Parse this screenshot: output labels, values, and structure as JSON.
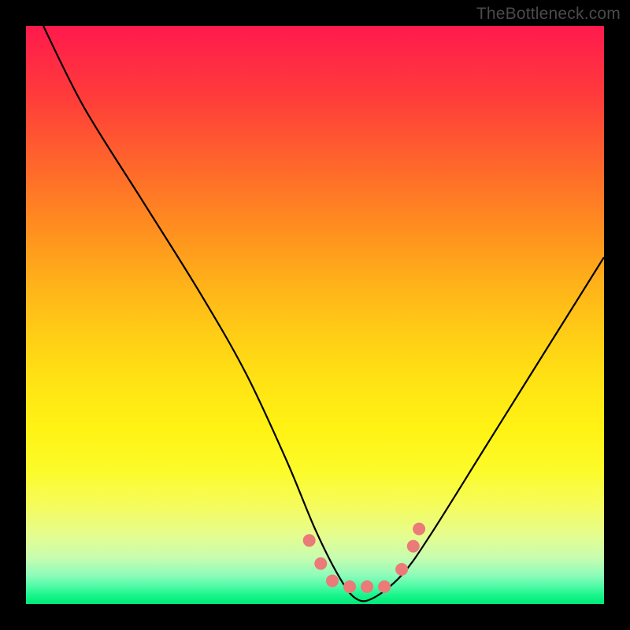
{
  "attribution": "TheBottleneck.com",
  "chart_data": {
    "type": "line",
    "title": "",
    "xlabel": "",
    "ylabel": "",
    "xlim": [
      0,
      100
    ],
    "ylim": [
      0,
      100
    ],
    "grid": false,
    "legend": false,
    "series": [
      {
        "name": "bottleneck-curve",
        "x": [
          3,
          10,
          20,
          30,
          38,
          45,
          50,
          54,
          57,
          60,
          65,
          70,
          80,
          90,
          100
        ],
        "y_pct": [
          100,
          86,
          70,
          54,
          40,
          25,
          13,
          5,
          1,
          1,
          5,
          12,
          28,
          44,
          60
        ],
        "stroke": "#000000",
        "stroke_width": 2.2
      }
    ],
    "markers": [
      {
        "x_pct": 49,
        "y_pct_from_top": 89,
        "r": 8,
        "fill": "#eb7a78"
      },
      {
        "x_pct": 51,
        "y_pct_from_top": 93,
        "r": 8,
        "fill": "#eb7a78"
      },
      {
        "x_pct": 53,
        "y_pct_from_top": 96,
        "r": 8,
        "fill": "#eb7a78"
      },
      {
        "x_pct": 56,
        "y_pct_from_top": 97,
        "r": 8,
        "fill": "#eb7a78"
      },
      {
        "x_pct": 59,
        "y_pct_from_top": 97,
        "r": 8,
        "fill": "#eb7a78"
      },
      {
        "x_pct": 62,
        "y_pct_from_top": 97,
        "r": 8,
        "fill": "#eb7a78"
      },
      {
        "x_pct": 65,
        "y_pct_from_top": 94,
        "r": 8,
        "fill": "#eb7a78"
      },
      {
        "x_pct": 67,
        "y_pct_from_top": 90,
        "r": 8,
        "fill": "#eb7a78"
      },
      {
        "x_pct": 68,
        "y_pct_from_top": 87,
        "r": 8,
        "fill": "#eb7a78"
      }
    ],
    "gradient_stops": [
      {
        "stop": 0,
        "color": "#ff1a4d"
      },
      {
        "stop": 0.25,
        "color": "#ff6a2a"
      },
      {
        "stop": 0.55,
        "color": "#ffd215"
      },
      {
        "stop": 0.77,
        "color": "#fcfb2a"
      },
      {
        "stop": 0.92,
        "color": "#c7fdb0"
      },
      {
        "stop": 1.0,
        "color": "#00e878"
      }
    ]
  }
}
